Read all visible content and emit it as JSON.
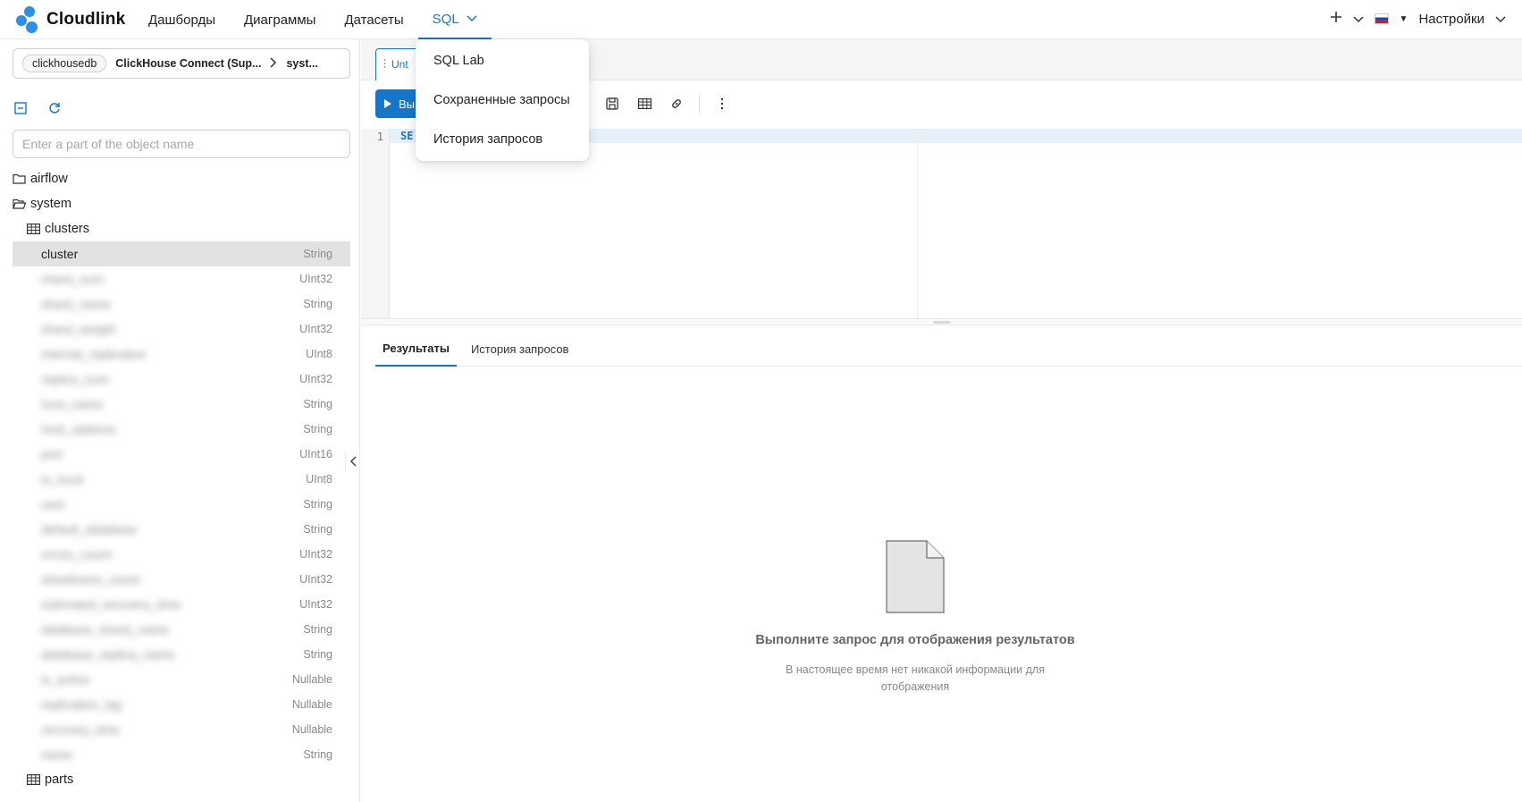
{
  "app": {
    "brand": "Cloudlink",
    "nav": [
      {
        "label": "Дашборды"
      },
      {
        "label": "Диаграммы"
      },
      {
        "label": "Датасеты"
      },
      {
        "label": "SQL"
      }
    ],
    "right": {
      "settings": "Настройки"
    }
  },
  "sql_menu": {
    "items": [
      {
        "label": "SQL Lab"
      },
      {
        "label": "Сохраненные запросы"
      },
      {
        "label": "История запросов"
      }
    ]
  },
  "sidebar": {
    "database": "clickhousedb",
    "connection": "ClickHouse Connect (Sup...",
    "schema": "syst...",
    "search_placeholder": "Enter a part of the object name",
    "tree": [
      {
        "label": "airflow"
      },
      {
        "label": "system"
      },
      {
        "label": "clusters"
      }
    ],
    "columns": [
      {
        "name": "cluster",
        "type": "String"
      },
      {
        "name": "shard_num",
        "type": "UInt32"
      },
      {
        "name": "shard_name",
        "type": "String"
      },
      {
        "name": "shard_weight",
        "type": "UInt32"
      },
      {
        "name": "internal_replication",
        "type": "UInt8"
      },
      {
        "name": "replica_num",
        "type": "UInt32"
      },
      {
        "name": "host_name",
        "type": "String"
      },
      {
        "name": "host_address",
        "type": "String"
      },
      {
        "name": "port",
        "type": "UInt16"
      },
      {
        "name": "is_local",
        "type": "UInt8"
      },
      {
        "name": "user",
        "type": "String"
      },
      {
        "name": "default_database",
        "type": "String"
      },
      {
        "name": "errors_count",
        "type": "UInt32"
      },
      {
        "name": "slowdowns_count",
        "type": "UInt32"
      },
      {
        "name": "estimated_recovery_time",
        "type": "UInt32"
      },
      {
        "name": "database_shard_name",
        "type": "String"
      },
      {
        "name": "database_replica_name",
        "type": "String"
      },
      {
        "name": "is_active",
        "type": "Nullable"
      },
      {
        "name": "replication_lag",
        "type": "Nullable"
      },
      {
        "name": "recovery_time",
        "type": "Nullable"
      },
      {
        "name": "name",
        "type": "String"
      }
    ],
    "tree_after": {
      "label": "parts"
    }
  },
  "editor": {
    "tab_label": "Unt",
    "run_label": "Вы",
    "line_number": "1",
    "code": "SE"
  },
  "results": {
    "tabs": [
      {
        "label": "Результаты"
      },
      {
        "label": "История запросов"
      }
    ],
    "empty_title": "Выполните запрос для отображения результатов",
    "empty_desc": "В настоящее время нет никакой информации для отображения"
  },
  "colors": {
    "accent": "#1677c8",
    "brand": "#2d8fe5"
  }
}
